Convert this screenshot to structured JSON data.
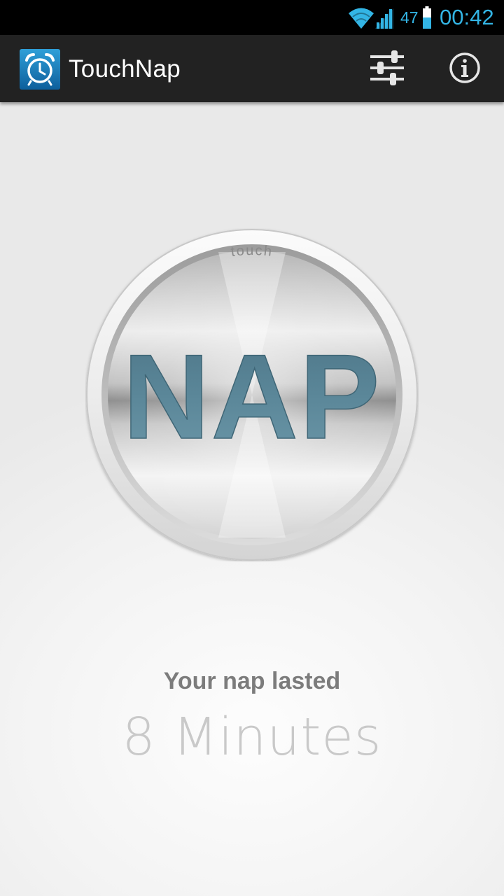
{
  "status_bar": {
    "battery_level": "47",
    "time": "00:42",
    "icons": [
      "wifi-icon",
      "signal-icon",
      "battery-icon"
    ],
    "accent_color": "#33b5e5"
  },
  "action_bar": {
    "title": "TouchNap",
    "app_icon": "alarm-clock-icon",
    "actions": [
      {
        "name": "settings",
        "icon": "sliders-icon"
      },
      {
        "name": "info",
        "icon": "info-icon"
      }
    ],
    "background_color": "#222222"
  },
  "nap_button": {
    "ring_label": "touch",
    "label": "NAP",
    "label_color": "#5b8799"
  },
  "result": {
    "label": "Your nap lasted",
    "value": "8 Minutes"
  }
}
